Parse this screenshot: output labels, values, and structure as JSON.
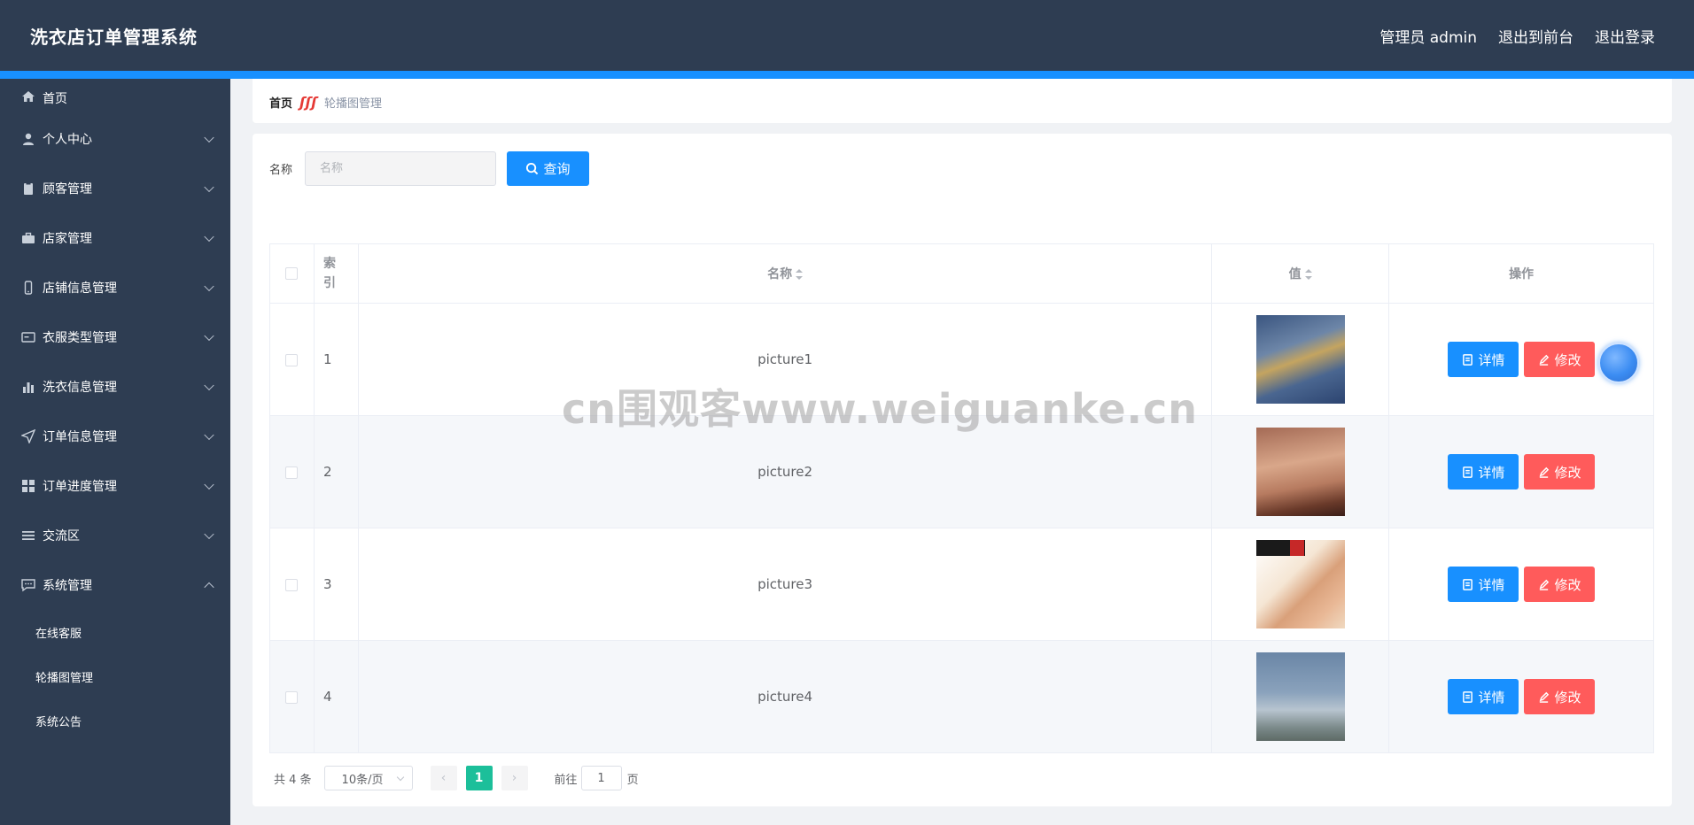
{
  "header": {
    "app_title": "洗衣店订单管理系统",
    "user_label": "管理员 admin",
    "front_link": "退出到前台",
    "logout_link": "退出登录"
  },
  "sidebar": {
    "items": [
      {
        "label": "首页",
        "icon": "home-icon"
      },
      {
        "label": "个人中心",
        "icon": "user-icon"
      },
      {
        "label": "顾客管理",
        "icon": "clipboard-icon"
      },
      {
        "label": "店家管理",
        "icon": "briefcase-icon"
      },
      {
        "label": "店铺信息管理",
        "icon": "phone-icon"
      },
      {
        "label": "衣服类型管理",
        "icon": "card-icon"
      },
      {
        "label": "洗衣信息管理",
        "icon": "bar-chart-icon"
      },
      {
        "label": "订单信息管理",
        "icon": "send-icon"
      },
      {
        "label": "订单进度管理",
        "icon": "grid-icon"
      },
      {
        "label": "交流区",
        "icon": "list-icon"
      },
      {
        "label": "系统管理",
        "icon": "chat-icon"
      }
    ],
    "sub_items": [
      "在线客服",
      "轮播图管理",
      "系统公告"
    ]
  },
  "breadcrumb": {
    "home": "首页",
    "separator": "ʃʃʃ",
    "current": "轮播图管理"
  },
  "search": {
    "label": "名称",
    "placeholder": "名称",
    "button_label": "查询"
  },
  "table": {
    "headers": {
      "index_line1": "索",
      "index_line2": "引",
      "name": "名称",
      "value": "值",
      "actions": "操作"
    },
    "rows": [
      {
        "index": "1",
        "name": "picture1"
      },
      {
        "index": "2",
        "name": "picture2"
      },
      {
        "index": "3",
        "name": "picture3"
      },
      {
        "index": "4",
        "name": "picture4"
      }
    ],
    "detail_label": "详情",
    "edit_label": "修改"
  },
  "pagination": {
    "total": "共 4 条",
    "page_size": "10条/页",
    "prev": "‹",
    "current_page": "1",
    "next": "›",
    "goto_label": "前往",
    "goto_value": "1",
    "page_suffix": "页"
  },
  "watermark": "cn围观客www.weiguanke.cn",
  "colors": {
    "header_bg": "#2e3d52",
    "accent": "#1890ff",
    "edit_button": "#ff5b5b",
    "active_page": "#1cbf9a"
  }
}
